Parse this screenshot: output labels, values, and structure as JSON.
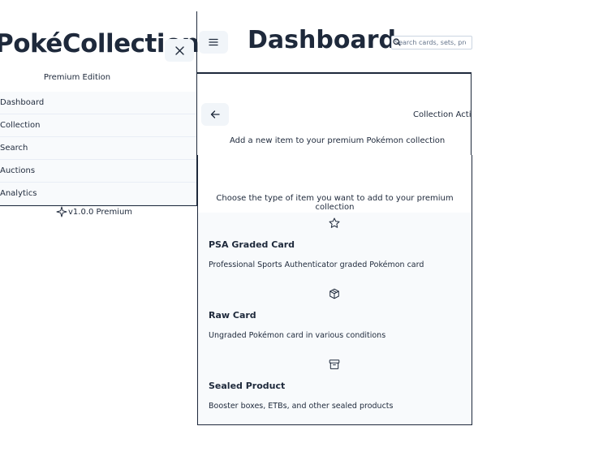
{
  "sidebar": {
    "brand_title": "PokéCollection",
    "brand_subtitle": "Premium Edition",
    "close_icon": "close-icon",
    "items": [
      {
        "label": "Dashboard"
      },
      {
        "label": "Collection"
      },
      {
        "label": "Search"
      },
      {
        "label": "Auctions"
      },
      {
        "label": "Analytics"
      }
    ],
    "version": "v1.0.0 Premium",
    "version_icon": "sparkle-icon"
  },
  "header": {
    "menu_icon": "menu-icon",
    "title": "Dashboard",
    "search_placeholder": "Search cards, sets, products...",
    "search_icon": "search-icon"
  },
  "modal": {
    "back_icon": "arrow-left-icon",
    "status_label": "Collection Active",
    "description": "Add a new item to your premium Pokémon collection",
    "prompt": "Choose the type of item you want to add to your premium collection",
    "options": [
      {
        "icon": "star-icon",
        "title": "PSA Graded Card",
        "description": "Professional Sports Authenticator graded Pokémon card"
      },
      {
        "icon": "box-icon",
        "title": "Raw Card",
        "description": "Ungraded Pokémon card in various conditions"
      },
      {
        "icon": "archive-icon",
        "title": "Sealed Product",
        "description": "Booster boxes, ETBs, and other sealed products"
      }
    ]
  },
  "colors": {
    "text": "#1e293b",
    "muted_bg": "#f8fafc",
    "button_bg": "#f1f5f9",
    "border": "#1e293b"
  }
}
